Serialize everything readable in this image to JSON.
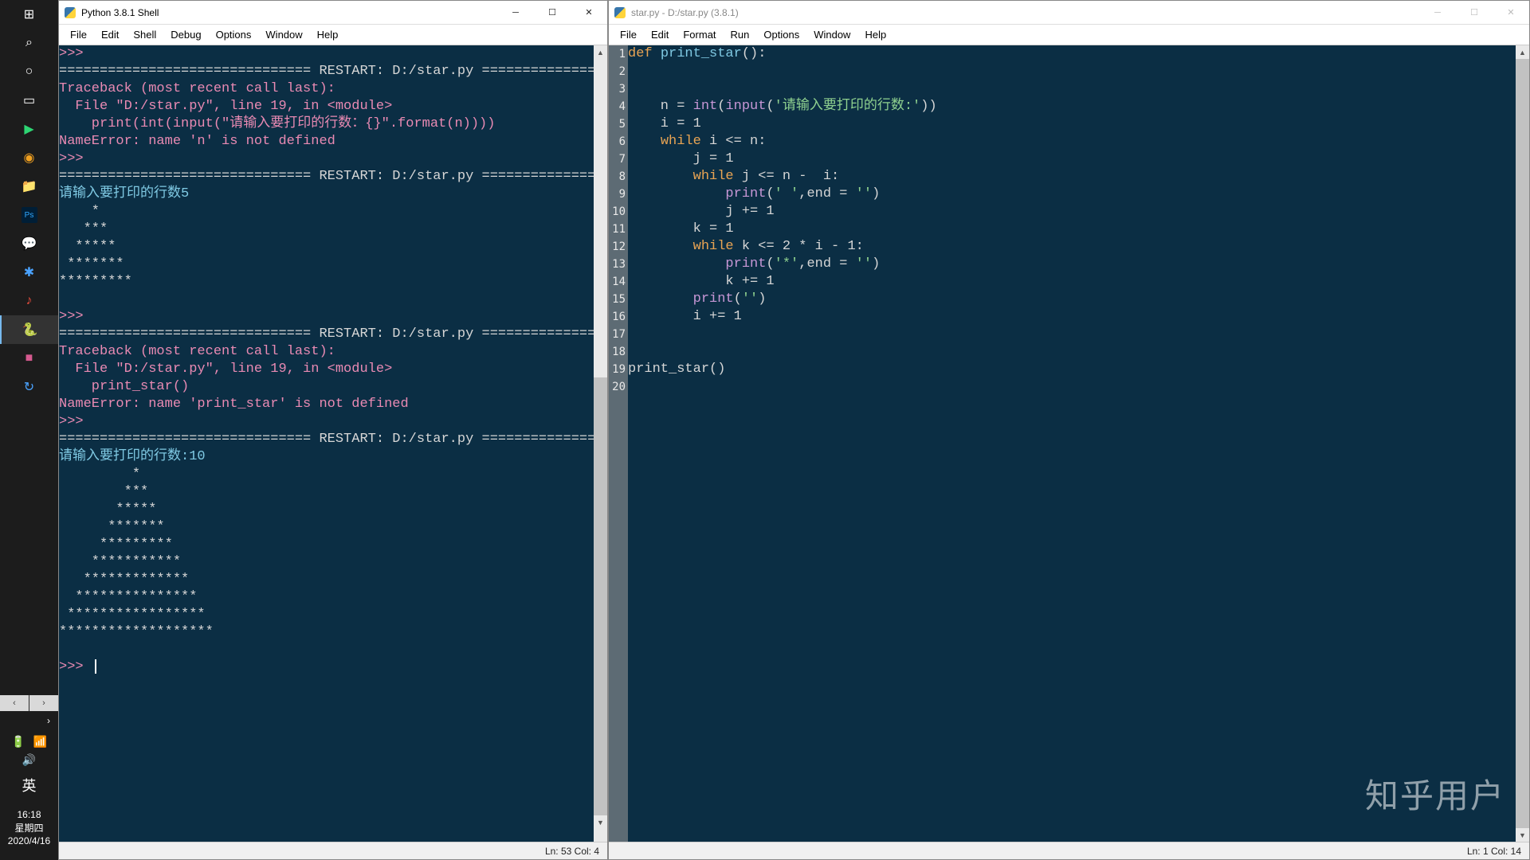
{
  "taskbar": {
    "scroll_left": "‹",
    "scroll_right": "›",
    "chevron": "›",
    "items": [
      {
        "name": "start",
        "glyph": "⊞"
      },
      {
        "name": "search",
        "glyph": "⌕"
      },
      {
        "name": "cortana",
        "glyph": "○"
      },
      {
        "name": "taskview",
        "glyph": "▭"
      },
      {
        "name": "video",
        "glyph": "▶",
        "color": "#2ed573"
      },
      {
        "name": "chrome",
        "glyph": "◉",
        "color": "#f0a020"
      },
      {
        "name": "explorer",
        "glyph": "📁"
      },
      {
        "name": "photoshop",
        "glyph": "Ps",
        "color": "#31a8ff"
      },
      {
        "name": "wechat",
        "glyph": "💬",
        "color": "#2dc100"
      },
      {
        "name": "apps",
        "glyph": "✱",
        "color": "#4aa3ff"
      },
      {
        "name": "music",
        "glyph": "♪",
        "color": "#e74c3c"
      },
      {
        "name": "idle",
        "glyph": "🐍",
        "active": true
      },
      {
        "name": "pink",
        "glyph": "■",
        "color": "#d65a8f"
      },
      {
        "name": "updater",
        "glyph": "↻",
        "color": "#4aa3ff"
      }
    ],
    "tray": {
      "battery": "🔋",
      "wifi": "📶",
      "volume": "🔊",
      "ime": "英",
      "time": "16:18",
      "day": "星期四",
      "date": "2020/4/16"
    }
  },
  "shell_window": {
    "title": "Python 3.8.1 Shell",
    "menus": [
      "File",
      "Edit",
      "Shell",
      "Debug",
      "Options",
      "Window",
      "Help"
    ],
    "status": "Ln: 53  Col: 4",
    "lines": [
      {
        "t": "prompt",
        "text": ">>> "
      },
      {
        "t": "restart",
        "text": "=============================== RESTART: D:/star.py ==============================="
      },
      {
        "t": "err",
        "text": "Traceback (most recent call last):"
      },
      {
        "t": "err",
        "text": "  File \"D:/star.py\", line 19, in <module>"
      },
      {
        "t": "err",
        "text": "    print(int(input(\"请输入要打印的行数：{}\".format(n))))"
      },
      {
        "t": "errname",
        "text": "NameError: name 'n' is not defined"
      },
      {
        "t": "prompt",
        "text": ">>> "
      },
      {
        "t": "restart",
        "text": "=============================== RESTART: D:/star.py ==============================="
      },
      {
        "t": "input",
        "text": "请输入要打印的行数5"
      },
      {
        "t": "out",
        "text": "    *"
      },
      {
        "t": "out",
        "text": "   ***"
      },
      {
        "t": "out",
        "text": "  *****"
      },
      {
        "t": "out",
        "text": " *******"
      },
      {
        "t": "out",
        "text": "*********"
      },
      {
        "t": "blank",
        "text": ""
      },
      {
        "t": "prompt",
        "text": ">>> "
      },
      {
        "t": "restart",
        "text": "=============================== RESTART: D:/star.py ==============================="
      },
      {
        "t": "err",
        "text": "Traceback (most recent call last):"
      },
      {
        "t": "err",
        "text": "  File \"D:/star.py\", line 19, in <module>"
      },
      {
        "t": "err",
        "text": "    print_star()"
      },
      {
        "t": "errname",
        "text": "NameError: name 'print_star' is not defined"
      },
      {
        "t": "prompt",
        "text": ">>> "
      },
      {
        "t": "restart",
        "text": "=============================== RESTART: D:/star.py ==============================="
      },
      {
        "t": "input",
        "text": "请输入要打印的行数:10"
      },
      {
        "t": "out",
        "text": "         *"
      },
      {
        "t": "out",
        "text": "        ***"
      },
      {
        "t": "out",
        "text": "       *****"
      },
      {
        "t": "out",
        "text": "      *******"
      },
      {
        "t": "out",
        "text": "     *********"
      },
      {
        "t": "out",
        "text": "    ***********"
      },
      {
        "t": "out",
        "text": "   *************"
      },
      {
        "t": "out",
        "text": "  ***************"
      },
      {
        "t": "out",
        "text": " *****************"
      },
      {
        "t": "out",
        "text": "*******************"
      },
      {
        "t": "blank",
        "text": ""
      },
      {
        "t": "prompt_cursor",
        "text": ">>> "
      }
    ]
  },
  "editor_window": {
    "title": "star.py - D:/star.py (3.8.1)",
    "menus": [
      "File",
      "Edit",
      "Format",
      "Run",
      "Options",
      "Window",
      "Help"
    ],
    "status": "Ln: 1  Col: 14",
    "line_numbers": [
      "1",
      "2",
      "3",
      "4",
      "5",
      "6",
      "7",
      "8",
      "9",
      "10",
      "11",
      "12",
      "13",
      "14",
      "15",
      "16",
      "17",
      "18",
      "19",
      "20"
    ],
    "code": [
      [
        {
          "c": "kw",
          "s": "def "
        },
        {
          "c": "fn",
          "s": "print_star"
        },
        {
          "c": "op",
          "s": "():"
        }
      ],
      [],
      [],
      [
        {
          "c": "op",
          "s": "    n = "
        },
        {
          "c": "builtin",
          "s": "int"
        },
        {
          "c": "op",
          "s": "("
        },
        {
          "c": "builtin",
          "s": "input"
        },
        {
          "c": "op",
          "s": "("
        },
        {
          "c": "str",
          "s": "'请输入要打印的行数:'"
        },
        {
          "c": "op",
          "s": "))"
        }
      ],
      [
        {
          "c": "op",
          "s": "    i = 1"
        }
      ],
      [
        {
          "c": "op",
          "s": "    "
        },
        {
          "c": "kw",
          "s": "while"
        },
        {
          "c": "op",
          "s": " i <= n:"
        }
      ],
      [
        {
          "c": "op",
          "s": "        j = 1"
        }
      ],
      [
        {
          "c": "op",
          "s": "        "
        },
        {
          "c": "kw",
          "s": "while"
        },
        {
          "c": "op",
          "s": " j <= n -  i:"
        }
      ],
      [
        {
          "c": "op",
          "s": "            "
        },
        {
          "c": "builtin",
          "s": "print"
        },
        {
          "c": "op",
          "s": "("
        },
        {
          "c": "str",
          "s": "' '"
        },
        {
          "c": "op",
          "s": ",end = "
        },
        {
          "c": "str",
          "s": "''"
        },
        {
          "c": "op",
          "s": ")"
        }
      ],
      [
        {
          "c": "op",
          "s": "            j += 1"
        }
      ],
      [
        {
          "c": "op",
          "s": "        k = 1"
        }
      ],
      [
        {
          "c": "op",
          "s": "        "
        },
        {
          "c": "kw",
          "s": "while"
        },
        {
          "c": "op",
          "s": " k <= 2 * i - 1:"
        }
      ],
      [
        {
          "c": "op",
          "s": "            "
        },
        {
          "c": "builtin",
          "s": "print"
        },
        {
          "c": "op",
          "s": "("
        },
        {
          "c": "str",
          "s": "'*'"
        },
        {
          "c": "op",
          "s": ",end = "
        },
        {
          "c": "str",
          "s": "''"
        },
        {
          "c": "op",
          "s": ")"
        }
      ],
      [
        {
          "c": "op",
          "s": "            k += 1"
        }
      ],
      [
        {
          "c": "op",
          "s": "        "
        },
        {
          "c": "builtin",
          "s": "print"
        },
        {
          "c": "op",
          "s": "("
        },
        {
          "c": "str",
          "s": "''"
        },
        {
          "c": "op",
          "s": ")"
        }
      ],
      [
        {
          "c": "op",
          "s": "        i += 1"
        }
      ],
      [],
      [],
      [
        {
          "c": "op",
          "s": "print_star()"
        }
      ],
      []
    ]
  },
  "watermark": "知乎用户"
}
